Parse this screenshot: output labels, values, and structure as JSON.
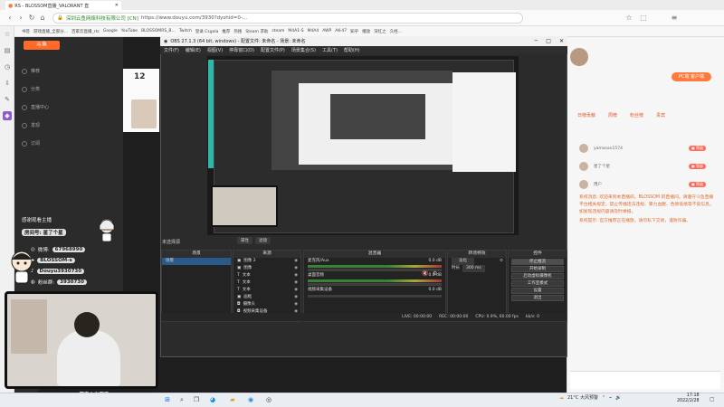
{
  "browser": {
    "tab_title": "RS - BLOSSOM直播_VALORANT 直",
    "url_host": "深圳云鱼网络科技有限公司 [CN]",
    "url_path": "https://www.douyu.com/3930?dyshid=0-...",
    "bookmarks": [
      "书签",
      "游戏直播_全部分...",
      "百家云直播_rtc",
      "Google",
      "YouTube",
      "BLOSSOMRS_B...",
      "Twitch",
      "登录 Csgola",
      "推荐",
      "热搜",
      "Steam 求助",
      "steam",
      "M4A1-S",
      "M4A4",
      "AWP",
      "AK-47",
      "知乎",
      "播放",
      "深红之",
      "久经..."
    ],
    "rank_badge": "12"
  },
  "sidebar": {
    "items": [
      "推荐",
      "分类",
      "直播中心",
      "发现",
      "订阅",
      "收藏"
    ]
  },
  "overlay": {
    "greeting": "感谢观看主播",
    "room": "房间号: 星了个星",
    "weibo_label": "微博:",
    "weibo_value": "67968990",
    "bili_value": "BLOSSOM-s",
    "douyin_value": "Douyu3930730",
    "qq_label": "粉丝群:",
    "qq_value": "3930730",
    "ticker": "都来上车开录"
  },
  "obs": {
    "title": "OBS 27.1.3 (64 bit, windows) - 配置文件: 未命名 - 场景: 未命名",
    "menu": [
      "文件(F)",
      "编辑(E)",
      "视图(V)",
      "停靠窗口(D)",
      "配置文件(P)",
      "场景集合(S)",
      "工具(T)",
      "帮助(H)"
    ],
    "scene_label": "未选择源",
    "preview_tabs": [
      "属性",
      "滤镜"
    ],
    "docks": {
      "scenes": {
        "title": "场景",
        "items": [
          "场景"
        ]
      },
      "sources": {
        "title": "来源",
        "items": [
          "图像 2",
          "图像",
          "文本",
          "文本",
          "文本",
          "画框",
          "摄像头",
          "视频采集设备"
        ]
      },
      "mixer": {
        "title": "混音器",
        "channels": [
          "麦克风/Aux",
          "桌面音频",
          "视频采集设备"
        ],
        "levels": [
          "0.0 dB",
          "0.0 dB",
          "0.0 dB"
        ]
      },
      "transitions": {
        "title": "转场特效",
        "type": "淡化",
        "duration_label": "时长",
        "duration_value": "300 ms"
      },
      "controls": {
        "title": "控件",
        "buttons": [
          "停止推流",
          "开始录制",
          "启动虚拟摄像机",
          "工作室模式",
          "设置",
          "退出"
        ]
      }
    },
    "status": {
      "live": "LIVE: 00:00:00",
      "rec": "REC: 00:00:00",
      "cpu": "CPU: 0.9%, 60.00 fps",
      "kb": "kb/s: 0"
    }
  },
  "chat": {
    "tabs": [
      "日榜贡献",
      "周榜",
      "粉丝榜",
      "贵宾"
    ],
    "pc_button": "PC端 客户端",
    "ranks": [
      {
        "name": "yamasan1574",
        "badge": "▣ 等级"
      },
      {
        "name": "星了个星",
        "badge": "▣ 等级"
      },
      {
        "name": "用户",
        "badge": "▣ 等级"
      }
    ],
    "messages": [
      "系统消息: 欢迎来到本直播间，BLOSSOM 的直播间。请遵守斗鱼直播平台相关规定，禁止传播违法违规、暴力血腥、色情低俗等不良信息，如发现违规内容请及时举报。",
      "系统提示: 官方推荐正在播放，请勿私下交易，谨防诈骗。"
    ]
  },
  "taskbar": {
    "weather": "21°C 大风预警",
    "time": "17:18",
    "date": "2022/2/28"
  }
}
